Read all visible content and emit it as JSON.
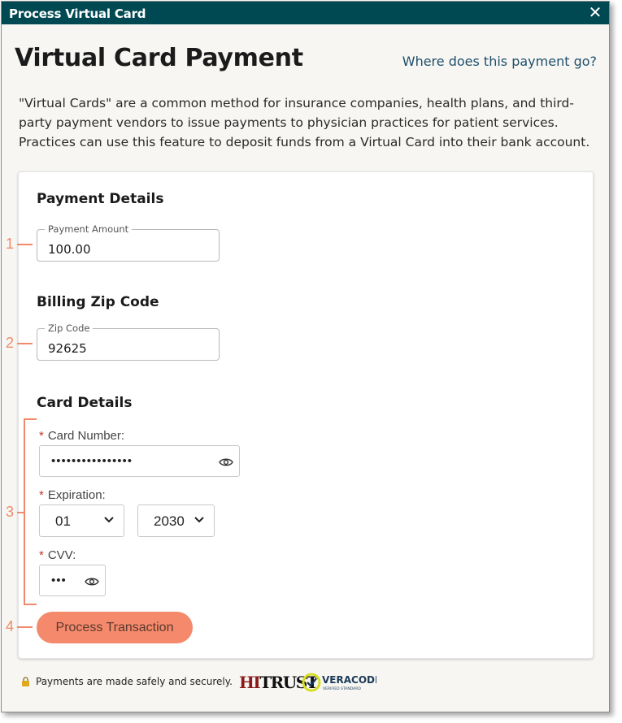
{
  "window": {
    "title": "Process Virtual Card",
    "close_label": "✕"
  },
  "header": {
    "title": "Virtual Card Payment",
    "help_link": "Where does this payment go?"
  },
  "intro": "\"Virtual Cards\" are a common method for insurance companies, health plans, and third-party payment vendors to issue payments to physician practices for patient services. Practices can use this feature to deposit funds from a Virtual Card into their bank account.",
  "payment_details": {
    "heading": "Payment Details",
    "amount_label": "Payment Amount",
    "amount_value": "100.00"
  },
  "billing": {
    "heading": "Billing Zip Code",
    "zip_label": "Zip Code",
    "zip_value": "92625"
  },
  "card_details": {
    "heading": "Card Details",
    "required_mark": "*",
    "card_number_label": "Card Number:",
    "card_number_value": "••••••••••••••••",
    "expiration_label": "Expiration:",
    "exp_month": "01",
    "exp_year": "2030",
    "cvv_label": "CVV:",
    "cvv_value": "•••"
  },
  "actions": {
    "process_label": "Process Transaction"
  },
  "footer": {
    "secure_text": "Payments are made safely and securely.",
    "hitrust_hi": "HI",
    "hitrust_rest": "TRUST",
    "veracode_name": "VERACODE",
    "veracode_sub": "VERIFIED STANDARD"
  },
  "annotations": {
    "n1": "1",
    "n2": "2",
    "n3": "3",
    "n4": "4"
  },
  "colors": {
    "titlebar": "#004852",
    "accent_button": "#f4896b",
    "annotation": "#f08a6a",
    "link": "#1e4f6b"
  },
  "icons": [
    "close-icon",
    "eye-icon",
    "chevron-down-icon",
    "lock-icon",
    "veracode-check-icon"
  ]
}
